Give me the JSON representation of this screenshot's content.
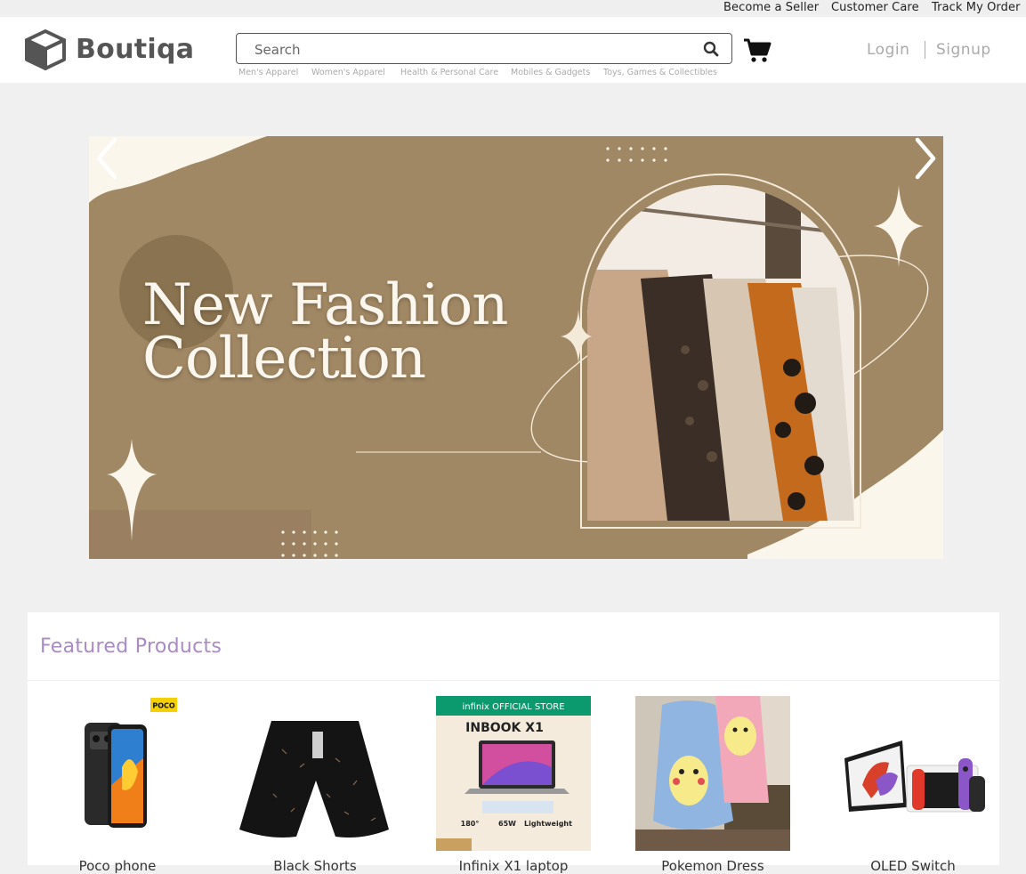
{
  "topbar": {
    "links": [
      "Become a Seller",
      "Customer Care",
      "Track My Order"
    ]
  },
  "header": {
    "brand": "Boutiqa",
    "search_placeholder": "Search",
    "categories": [
      "Men's Apparel",
      "Women's Apparel",
      "Health & Personal Care",
      "Mobiles & Gadgets",
      "Toys, Games & Collectibles"
    ],
    "login_label": "Login",
    "signup_label": "Signup"
  },
  "banner": {
    "title_line1": "New Fashion",
    "title_line2": "Collection"
  },
  "featured": {
    "title": "Featured Products",
    "products": [
      {
        "name": "Poco phone",
        "badge": "POCO"
      },
      {
        "name": "Black Shorts"
      },
      {
        "name": "Infinix X1 laptop",
        "store_label": "infinix OFFICIAL STORE",
        "model": "INBOOK X1",
        "spec1": "180°",
        "spec2": "65W",
        "spec3": "Lightweight"
      },
      {
        "name": "Pokemon Dress"
      },
      {
        "name": "OLED Switch"
      }
    ]
  },
  "colors": {
    "banner_bg": "#a18864",
    "featured_title": "#a88ac4",
    "page_bg": "#f0f0f0"
  }
}
